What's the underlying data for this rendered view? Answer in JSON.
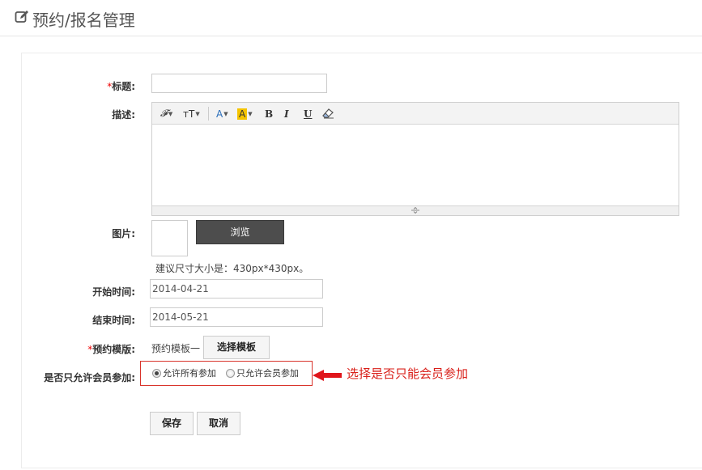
{
  "header": {
    "title": "预约/报名管理",
    "icon": "edit-icon"
  },
  "form": {
    "title_label": "标题:",
    "title_value": "",
    "desc_label": "描述:",
    "editor": {
      "toolbar": {
        "font_family": "𝓕",
        "font_size": "тT",
        "font_color": "A",
        "bg_color": "A",
        "bold": "B",
        "italic": "I",
        "underline": "U"
      },
      "content": ""
    },
    "image_label": "图片:",
    "browse_label": "浏览",
    "image_hint": "建议尺寸大小是：430px*430px。",
    "start_label": "开始时间:",
    "start_value": "2014-04-21",
    "end_label": "结束时间:",
    "end_value": "2014-05-21",
    "template_label": "预约模版:",
    "template_value": "预约模板一",
    "select_template_label": "选择模板",
    "member_label": "是否只允许会员参加:",
    "radio_all_label": "允许所有参加",
    "radio_member_label": "只允许会员参加",
    "radio_selected": "all",
    "annotation": "选择是否只能会员参加",
    "save_label": "保存",
    "cancel_label": "取消",
    "required_mark": "*"
  },
  "colors": {
    "required": "#ee0000",
    "annotation": "#d9201a",
    "highlight_box": "#d9342b",
    "browse_bg": "#4d4d4d"
  }
}
